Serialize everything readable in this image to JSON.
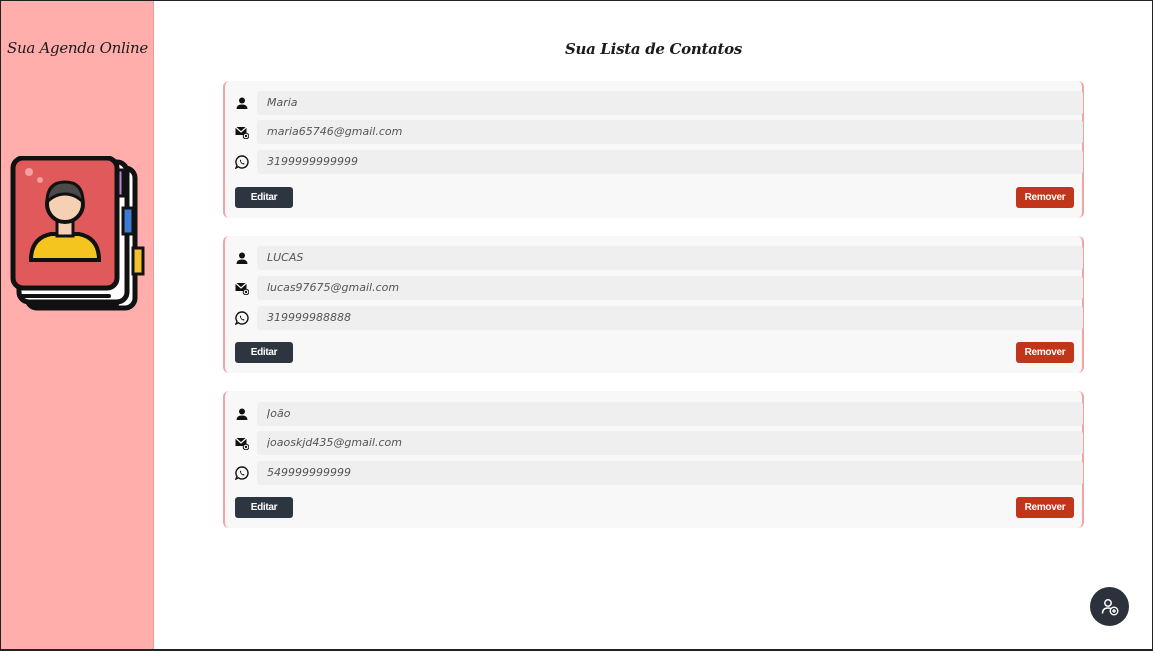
{
  "sidebar": {
    "brand": "Sua Agenda Online"
  },
  "main": {
    "title": "Sua Lista de Contatos"
  },
  "contacts": [
    {
      "name": "Maria",
      "email": "maria65746@gmail.com",
      "phone": "3199999999999",
      "edit_label": "Editar",
      "remove_label": "Remover"
    },
    {
      "name": "LUCAS",
      "email": "lucas97675@gmail.com",
      "phone": "319999988888",
      "edit_label": "Editar",
      "remove_label": "Remover"
    },
    {
      "name": "João",
      "email": "joaoskjd435@gmail.com",
      "phone": "549999999999",
      "edit_label": "Editar",
      "remove_label": "Remover"
    }
  ],
  "icons": {
    "name": "person-icon",
    "email": "email-icon",
    "phone": "whatsapp-icon",
    "fab": "add-contact-icon"
  },
  "colors": {
    "sidebar": "#ffaeac",
    "edit_button": "#2d3540",
    "remove_button": "#c1361a",
    "fab": "#2b323b",
    "card_border": "#f3a3a1"
  }
}
